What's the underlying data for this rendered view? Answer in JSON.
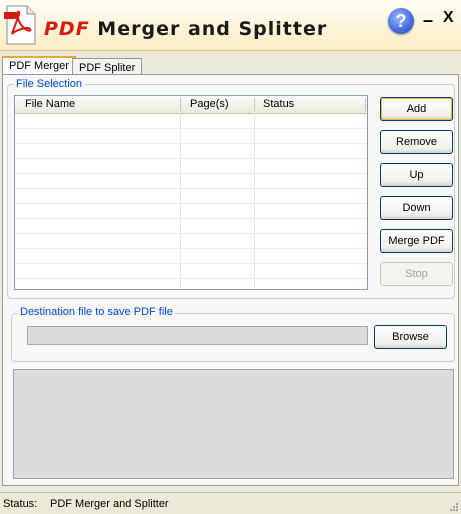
{
  "titlebar": {
    "title_pdf": "PDF",
    "title_rest": " Merger and Splitter",
    "help_label": "?",
    "minimize_label": "–",
    "close_label": "X"
  },
  "tabs": [
    {
      "label": "PDF Merger",
      "active": true
    },
    {
      "label": "PDF Spliter",
      "active": false
    }
  ],
  "file_selection": {
    "legend": "File Selection",
    "columns": [
      "File Name",
      "Page(s)",
      "Status"
    ],
    "rows": []
  },
  "buttons": {
    "add": "Add",
    "remove": "Remove",
    "up": "Up",
    "down": "Down",
    "merge": "Merge PDF",
    "stop": "Stop"
  },
  "destination": {
    "legend": "Destination file to save PDF file",
    "value": "",
    "browse": "Browse"
  },
  "status": {
    "label": "Status:",
    "text": "PDF Merger and Splitter"
  },
  "colors": {
    "accent_red": "#d41d12",
    "legend_blue": "#0046d5",
    "button_border": "#003c74"
  }
}
